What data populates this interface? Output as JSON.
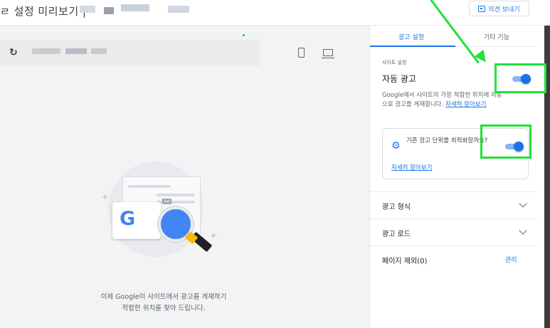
{
  "header": {
    "title": "ㄹ 설정 미리보기 |",
    "feedback_label": "의견 보내기"
  },
  "preview": {
    "message_line1": "이제 Google이 사이트에서 광고를 게재하기",
    "message_line2": "적합한 위치를 찾아 드립니다.",
    "reload_icon": "↻",
    "ad_badge": "Ad",
    "g_letter": "G"
  },
  "panel": {
    "tabs": [
      {
        "label": "광고 설정",
        "selected": true
      },
      {
        "label": "기타 기능",
        "selected": false
      }
    ],
    "site_section_label": "사이트 설정",
    "auto_ads": {
      "title": "자동 광고",
      "description": "Google에서 사이트의 가장 적합한 위치에 자동으로 광고를 게재합니다.",
      "learn_more": "자세히 알아보기",
      "enabled": true
    },
    "optimize": {
      "text": "기존 광고 단위를 최적화할까요?",
      "learn_more": "자세히 알아보기",
      "enabled": true
    },
    "sections": [
      {
        "label": "광고 형식"
      },
      {
        "label": "광고 로드"
      },
      {
        "label": "페이지 제외(0)",
        "action": "관리"
      }
    ]
  },
  "colors": {
    "accent": "#1a73e8",
    "annotation": "#23e03a"
  }
}
